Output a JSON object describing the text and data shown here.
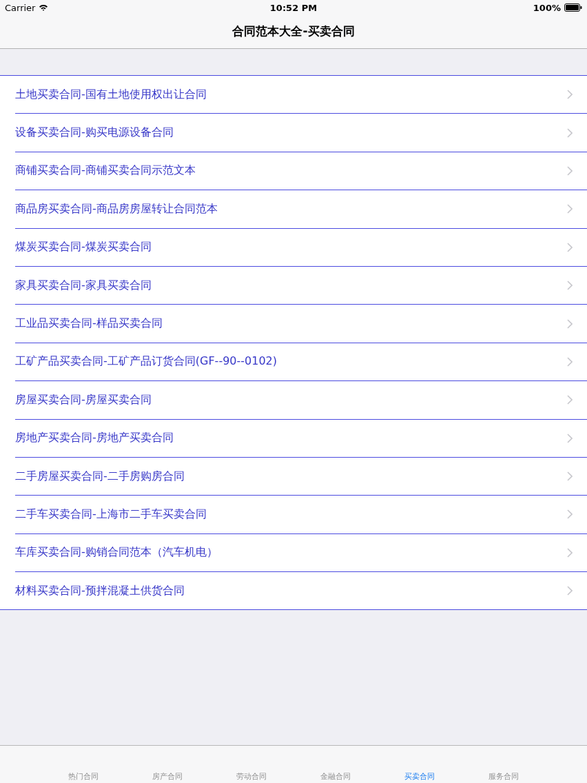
{
  "status_bar": {
    "carrier": "Carrier",
    "time": "10:52 PM",
    "battery": "100%"
  },
  "nav_bar": {
    "title": "合同范本大全-买卖合同"
  },
  "list": {
    "items": [
      {
        "label": "土地买卖合同-国有土地使用权出让合同"
      },
      {
        "label": "设备买卖合同-购买电源设备合同"
      },
      {
        "label": "商铺买卖合同-商铺买卖合同示范文本"
      },
      {
        "label": "商品房买卖合同-商品房房屋转让合同范本"
      },
      {
        "label": "煤炭买卖合同-煤炭买卖合同"
      },
      {
        "label": "家具买卖合同-家具买卖合同"
      },
      {
        "label": "工业品买卖合同-样品买卖合同"
      },
      {
        "label": "工矿产品买卖合同-工矿产品订货合同(GF--90--0102)"
      },
      {
        "label": "房屋买卖合同-房屋买卖合同"
      },
      {
        "label": "房地产买卖合同-房地产买卖合同"
      },
      {
        "label": "二手房屋买卖合同-二手房购房合同"
      },
      {
        "label": "二手车买卖合同-上海市二手车买卖合同"
      },
      {
        "label": "车库买卖合同-购销合同范本（汽车机电）"
      },
      {
        "label": "材料买卖合同-预拌混凝土供货合同"
      }
    ]
  },
  "tab_bar": {
    "tabs": [
      {
        "label": "热门合同",
        "selected": false
      },
      {
        "label": "房产合同",
        "selected": false
      },
      {
        "label": "劳动合同",
        "selected": false
      },
      {
        "label": "金融合同",
        "selected": false
      },
      {
        "label": "买卖合同",
        "selected": true
      },
      {
        "label": "服务合同",
        "selected": false
      }
    ]
  }
}
